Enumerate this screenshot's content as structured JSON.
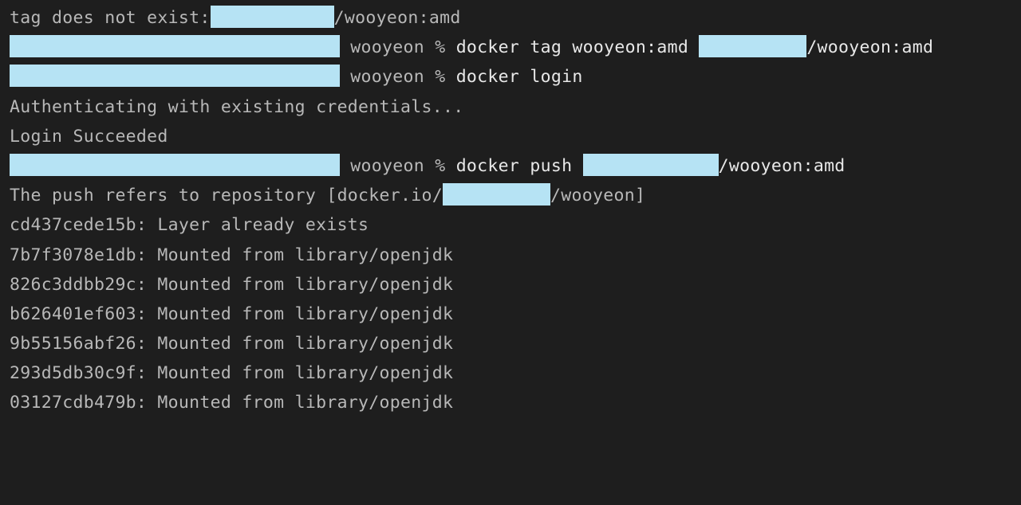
{
  "lines": {
    "err_pre": "tag does not exist:",
    "err_post": "/wooyeon:amd",
    "prompt_suffix": " wooyeon % ",
    "cmd_tag_pre": "docker tag wooyeon:amd ",
    "cmd_tag_post": "/wooyeon:amd",
    "cmd_login": "docker login",
    "auth": "Authenticating with existing credentials...",
    "login_ok": "Login Succeeded",
    "cmd_push_pre": "docker push ",
    "cmd_push_post": "/wooyeon:amd",
    "push_ref_pre": "The push refers to repository [docker.io/",
    "push_ref_post": "/wooyeon]",
    "layers": [
      "cd437cede15b: Layer already exists",
      "7b7f3078e1db: Mounted from library/openjdk",
      "826c3ddbb29c: Mounted from library/openjdk",
      "b626401ef603: Mounted from library/openjdk",
      "9b55156abf26: Mounted from library/openjdk",
      "293d5db30c9f: Mounted from library/openjdk",
      "03127cdb479b: Mounted from library/openjdk"
    ]
  }
}
